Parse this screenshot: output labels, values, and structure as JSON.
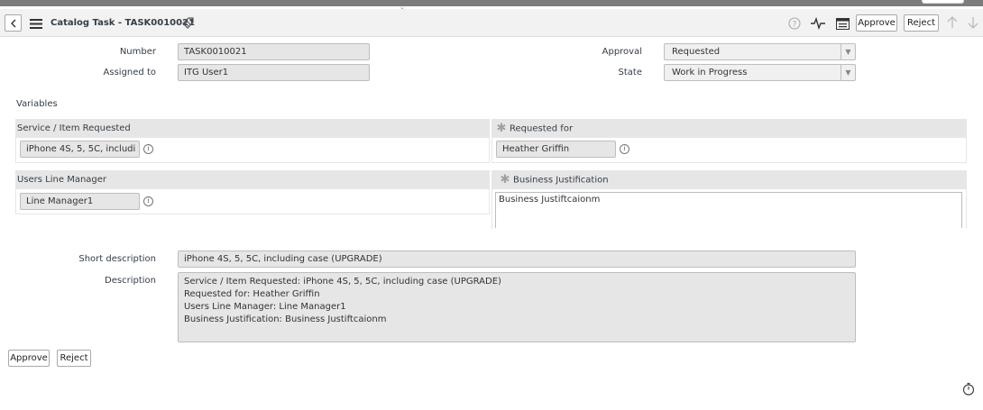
{
  "header": {
    "title": "Catalog Task - TASK0010021",
    "approve_label": "Approve",
    "reject_label": "Reject"
  },
  "form": {
    "number_label": "Number",
    "number_value": "TASK0010021",
    "assigned_label": "Assigned to",
    "assigned_value": "ITG User1",
    "approval_label": "Approval",
    "approval_value": "Requested",
    "state_label": "State",
    "state_value": "Work in Progress",
    "variables_label": "Variables",
    "service_label": "Service / Item Requested",
    "service_value": "iPhone 4S, 5, 5C, includi",
    "requested_for_label": "Requested for",
    "requested_for_value": "Heather Griffin",
    "manager_label": "Users Line Manager",
    "manager_value": "Line Manager1",
    "justification_label": "Business Justification",
    "justification_value": "Business Justiftcaionm",
    "short_desc_label": "Short description",
    "short_desc_value": "iPhone 4S, 5, 5C, including case (UPGRADE)",
    "description_label": "Description",
    "description_lines": [
      "Service / Item Requested: iPhone 4S, 5, 5C, including case (UPGRADE)",
      "Requested for: Heather Griffin",
      "Users Line Manager: Line Manager1",
      "Business Justification: Business Justiftcaionm"
    ]
  },
  "footer": {
    "approve_label": "Approve",
    "reject_label": "Reject"
  },
  "icons": {
    "back": "back-chevron-icon",
    "menu": "hamburger-menu-icon",
    "tag": "attachment-tag-icon",
    "help": "help-circle-icon",
    "activity": "activity-pulse-icon",
    "settings": "form-settings-icon",
    "up": "arrow-up-icon",
    "down": "arrow-down-icon",
    "timer": "stopwatch-icon"
  }
}
